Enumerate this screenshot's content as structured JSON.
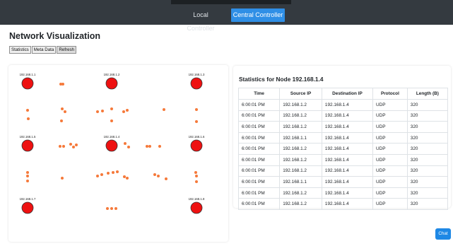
{
  "navbar": {
    "links": [
      {
        "label": "Local Controller",
        "active": false
      },
      {
        "label": "Central Controller",
        "active": true
      }
    ],
    "active_color": "#2f8fe6"
  },
  "page": {
    "title": "Network Visualization",
    "toolbar": [
      {
        "label": "Statistics",
        "active": false
      },
      {
        "label": "Meta Data",
        "active": false
      },
      {
        "label": "Refresh",
        "active": true
      }
    ]
  },
  "network": {
    "node_color": "#ee1111",
    "packet_color": "#f5793a",
    "nodes": [
      {
        "label": "192.168.1.1"
      },
      {
        "label": "192.168.1.2"
      },
      {
        "label": "192.168.1.3"
      },
      {
        "label": "192.168.1.5"
      },
      {
        "label": "192.168.1.4"
      },
      {
        "label": "192.168.1.6"
      },
      {
        "label": "192.168.1.7"
      },
      {
        "label": "192.168.1.8"
      }
    ]
  },
  "stats": {
    "title": "Statistics for Node 192.168.1.4",
    "columns": [
      "Time",
      "Source IP",
      "Destination IP",
      "Protocol",
      "Length (B)"
    ],
    "rows": [
      [
        "6:00:01 PM",
        "192.168.1.2",
        "192.168.1.4",
        "UDP",
        "320"
      ],
      [
        "6:00:01 PM",
        "192.168.1.2",
        "192.168.1.4",
        "UDP",
        "320"
      ],
      [
        "6:00:01 PM",
        "192.168.1.2",
        "192.168.1.4",
        "UDP",
        "320"
      ],
      [
        "6:00:01 PM",
        "192.168.1.1",
        "192.168.1.4",
        "UDP",
        "320"
      ],
      [
        "6:00:01 PM",
        "192.168.1.2",
        "192.168.1.4",
        "UDP",
        "320"
      ],
      [
        "6:00:01 PM",
        "192.168.1.2",
        "192.168.1.4",
        "UDP",
        "320"
      ],
      [
        "6:00:01 PM",
        "192.168.1.2",
        "192.168.1.4",
        "UDP",
        "320"
      ],
      [
        "6:00:01 PM",
        "192.168.1.1",
        "192.168.1.4",
        "UDP",
        "320"
      ],
      [
        "6:00:01 PM",
        "192.168.1.2",
        "192.168.1.4",
        "UDP",
        "320"
      ],
      [
        "6:00:01 PM",
        "192.168.1.2",
        "192.168.1.4",
        "UDP",
        "320"
      ]
    ]
  },
  "chat": {
    "label": "Chat"
  }
}
